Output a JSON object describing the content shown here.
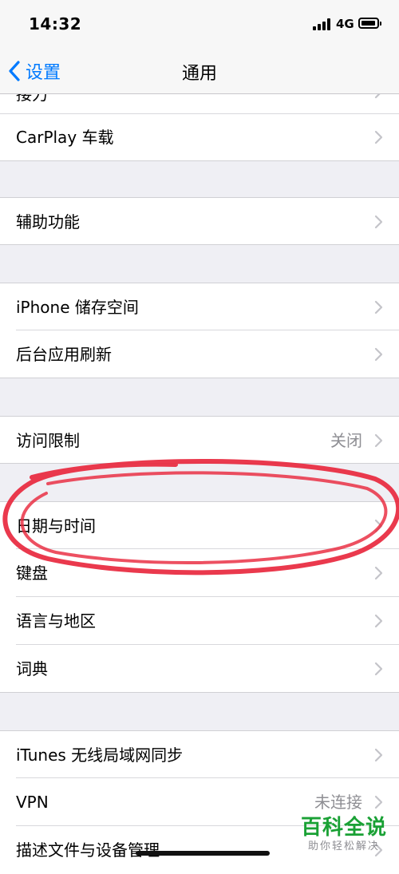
{
  "status_bar": {
    "time": "14:32",
    "network": "4G"
  },
  "nav": {
    "back_label": "设置",
    "title": "通用"
  },
  "cutoff_row": {
    "label": "接力"
  },
  "rows": {
    "carplay": {
      "label": "CarPlay 车载"
    },
    "accessibility": {
      "label": "辅助功能"
    },
    "storage": {
      "label": "iPhone 储存空间"
    },
    "bg_refresh": {
      "label": "后台应用刷新"
    },
    "restrictions": {
      "label": "访问限制",
      "value": "关闭"
    },
    "date_time": {
      "label": "日期与时间"
    },
    "keyboard": {
      "label": "键盘"
    },
    "language": {
      "label": "语言与地区"
    },
    "dictionary": {
      "label": "词典"
    },
    "itunes_sync": {
      "label": "iTunes 无线局域网同步"
    },
    "vpn": {
      "label": "VPN",
      "value": "未连接"
    },
    "profiles": {
      "label": "描述文件与设备管理"
    }
  },
  "watermark": {
    "title": "百科全说",
    "subtitle": "助你轻松解决"
  },
  "colors": {
    "accent": "#007aff",
    "annotation": "#e8243a",
    "watermark": "#1aa135"
  }
}
